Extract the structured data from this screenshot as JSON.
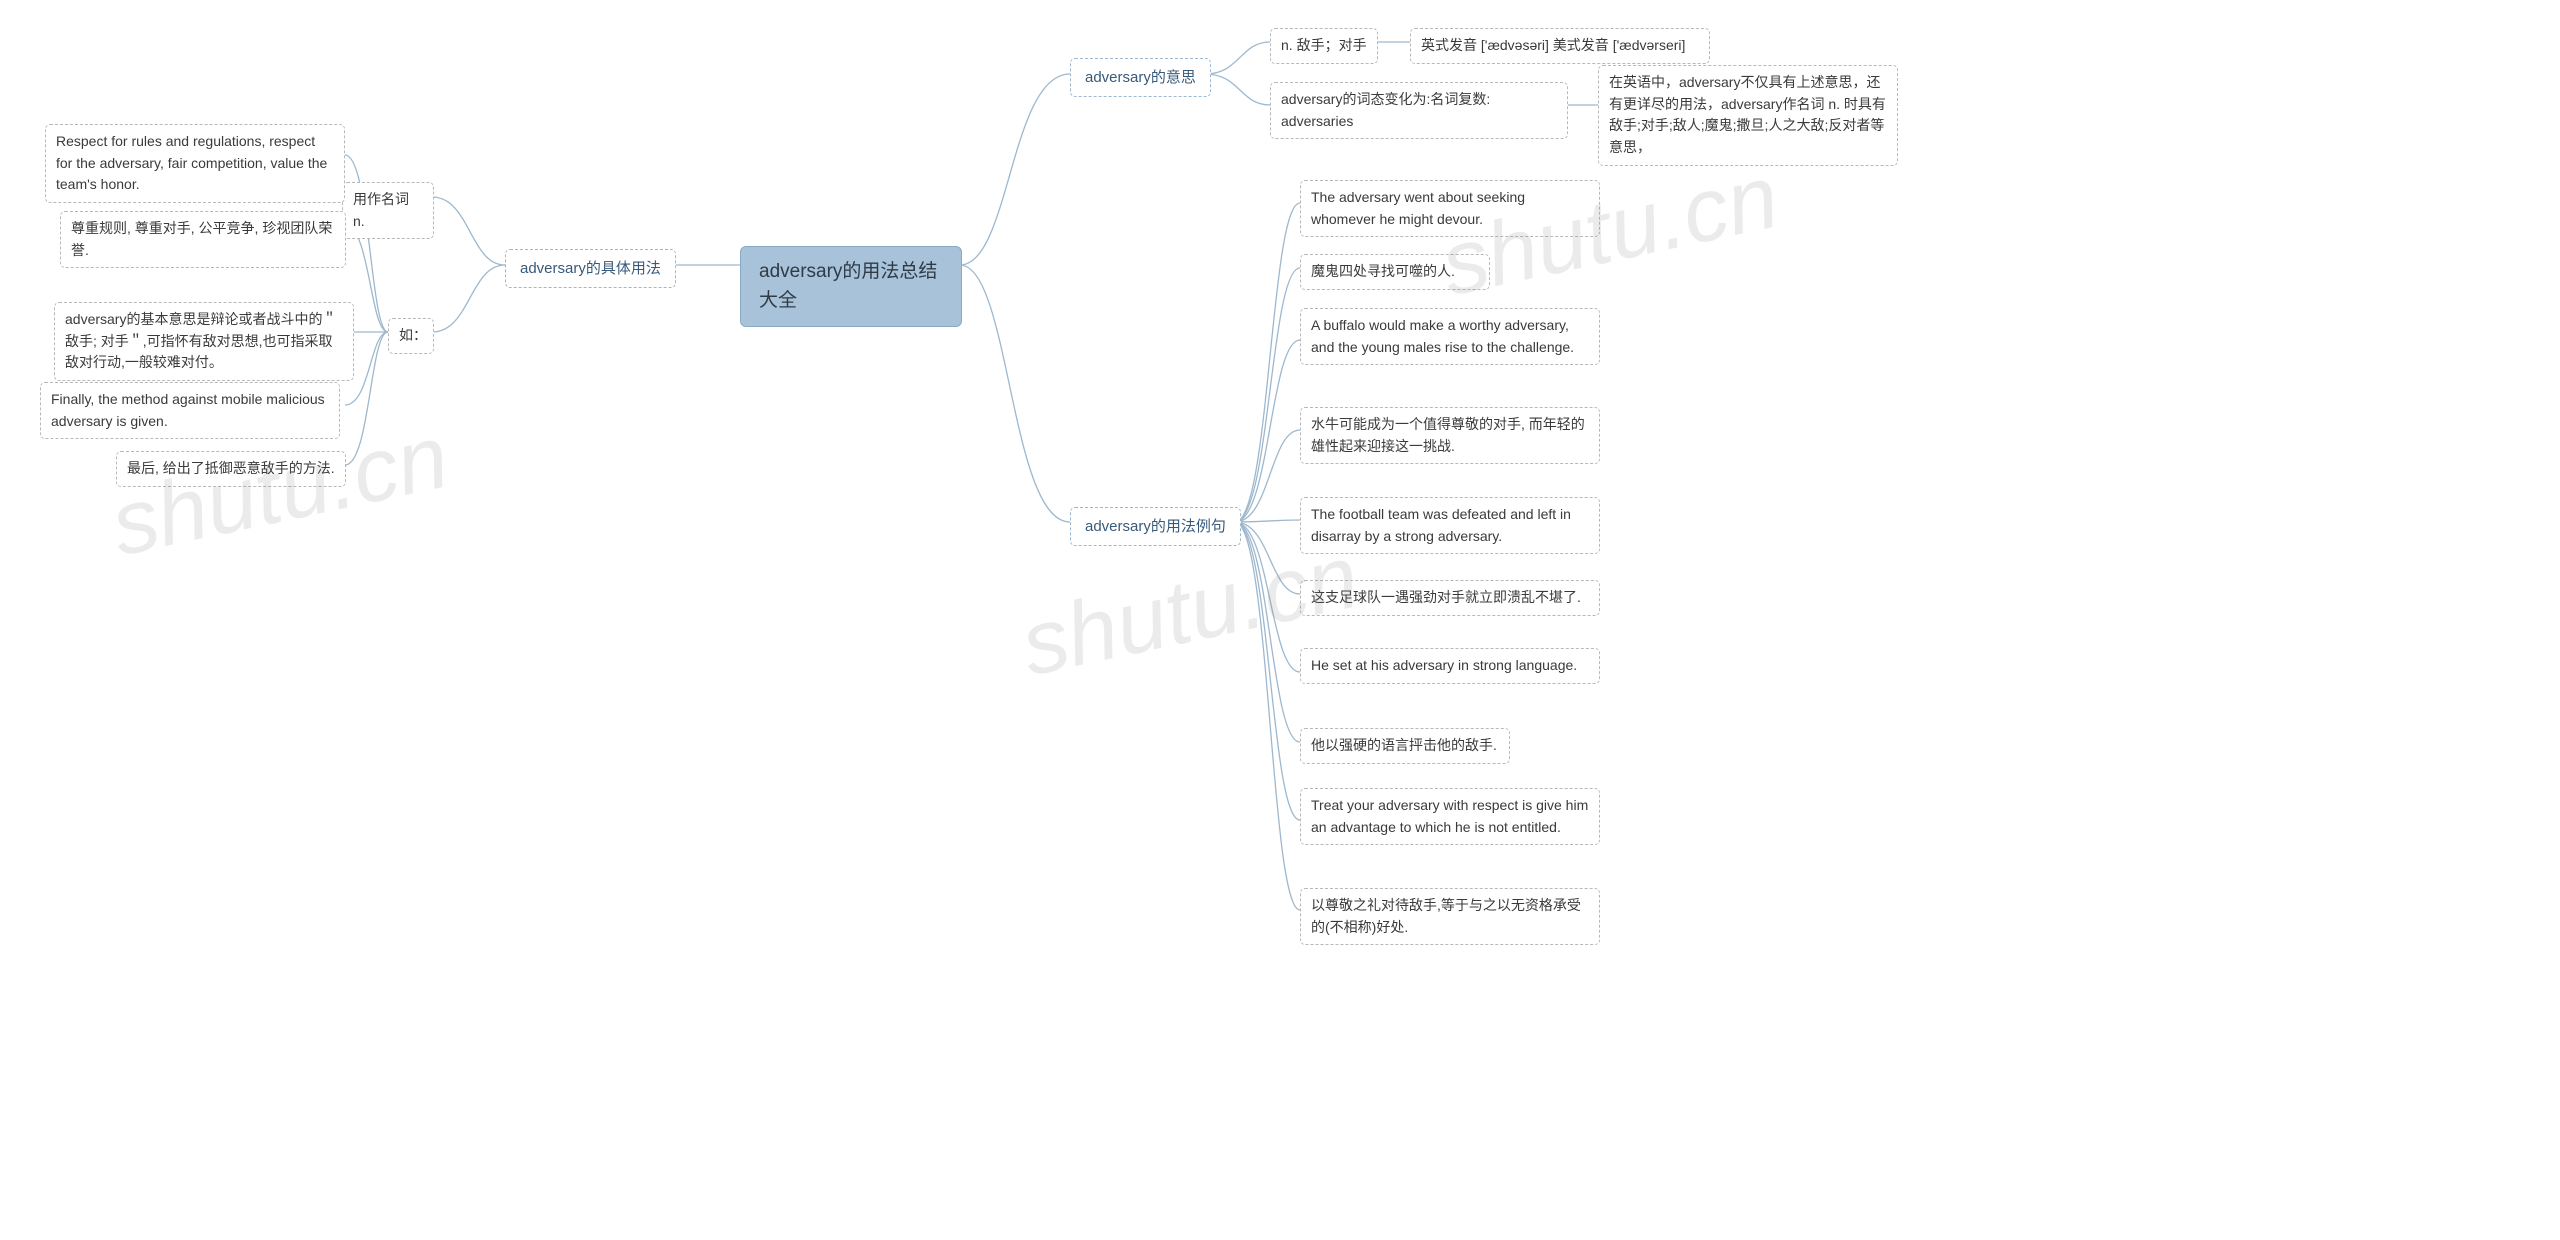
{
  "watermark": "shutu.cn",
  "root": {
    "label": "adversary的用法总结大全"
  },
  "right": {
    "meaning": {
      "label": "adversary的意思",
      "row1": {
        "a": "n. 敌手；对手",
        "b": "英式发音 ['ædvəsəri] 美式发音 ['ædvərseri]"
      },
      "row2": {
        "a": "adversary的词态变化为:名词复数: adversaries",
        "b": "在英语中，adversary不仅具有上述意思，还有更详尽的用法，adversary作名词 n. 时具有敌手;对手;敌人;魔鬼;撒旦;人之大敌;反对者等意思，"
      }
    },
    "examples": {
      "label": "adversary的用法例句",
      "items": [
        "The adversary went about seeking whomever he might devour.",
        "魔鬼四处寻找可噬的人.",
        "A buffalo would make a worthy adversary, and the young males rise to the challenge.",
        "水牛可能成为一个值得尊敬的对手, 而年轻的雄性起来迎接这一挑战.",
        "The football team was defeated and left in disarray by a strong adversary.",
        "这支足球队一遇强劲对手就立即溃乱不堪了.",
        "He set at his adversary in strong language.",
        "他以强硬的语言抨击他的敌手.",
        "Treat your adversary with respect is give him an advantage to which he is not entitled.",
        "以尊敬之礼对待敌手,等于与之以无资格承受的(不相称)好处."
      ]
    }
  },
  "left": {
    "usage": {
      "label": "adversary的具体用法",
      "noun": "用作名词 n.",
      "eg_label": "如：",
      "eg_desc": "adversary的基本意思是辩论或者战斗中的＂敌手; 对手＂,可指怀有敌对思想,也可指采取敌对行动,一般较难对付。",
      "items": [
        "Respect for rules and regulations, respect for the adversary, fair competition, value the team's honor.",
        "尊重规则, 尊重对手, 公平竞争, 珍视团队荣誉.",
        "Finally, the method against mobile malicious adversary is given.",
        "最后, 给出了抵御恶意敌手的方法."
      ]
    }
  }
}
